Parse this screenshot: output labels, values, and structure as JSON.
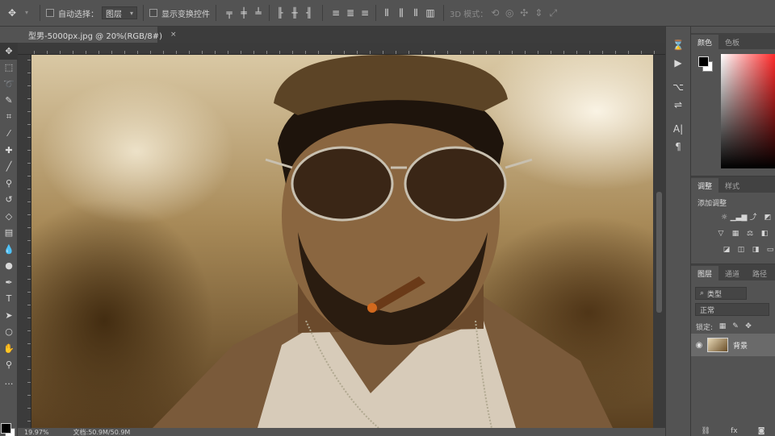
{
  "optbar": {
    "move_icon": "move-icon",
    "auto_select_label": "自动选择：",
    "target_value": "图层",
    "show_transform_label": "显示变换控件",
    "mode_3d_label": "3D 模式："
  },
  "document": {
    "tab_title": "型男-5000px.jpg @ 20%(RGB/8#)",
    "close_glyph": "×"
  },
  "status": {
    "zoom": "19.97%",
    "doc_info": "文档:50.9M/50.9M"
  },
  "color_panel": {
    "tabs": [
      "颜色",
      "色板"
    ],
    "foreground": "#000000",
    "background": "#ffffff"
  },
  "adjustments_panel": {
    "tabs": [
      "调整",
      "样式"
    ],
    "title": "添加调整"
  },
  "layers_panel": {
    "tabs": [
      "图层",
      "通道",
      "路径"
    ],
    "filter_placeholder": "类型",
    "blend_mode": "正常",
    "lock_label": "锁定:",
    "layer_name": "背景"
  }
}
